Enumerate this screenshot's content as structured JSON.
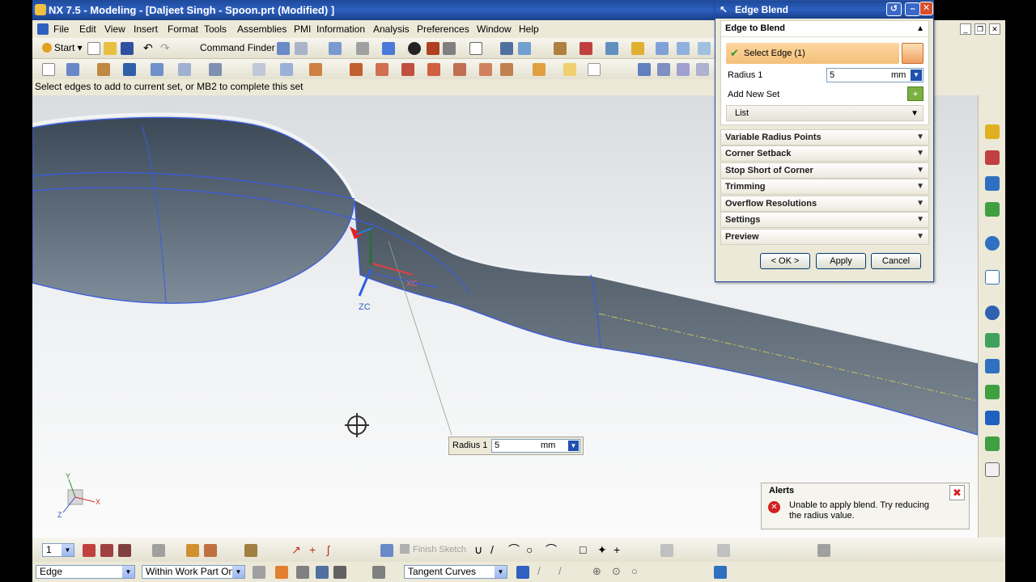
{
  "window": {
    "title": "NX 7.5 - Modeling - [Daljeet Singh - Spoon.prt (Modified) ]"
  },
  "menu": [
    "File",
    "Edit",
    "View",
    "Insert",
    "Format",
    "Tools",
    "Assemblies",
    "PMI",
    "Information",
    "Analysis",
    "Preferences",
    "Window",
    "Help"
  ],
  "toolbar": {
    "start_label": "Start",
    "command_finder_label": "Command Finder"
  },
  "status": {
    "prompt": "Select edges to add to current set, or MB2 to complete this set"
  },
  "dialog": {
    "title": "Edge Blend",
    "section_title": "Edge to Blend",
    "select_edge": "Select Edge (1)",
    "radius_label": "Radius 1",
    "radius_value": "5",
    "radius_unit": "mm",
    "add_new_set": "Add New Set",
    "list_label": "List",
    "collapsed_sections": [
      "Variable Radius Points",
      "Corner Setback",
      "Stop Short of Corner",
      "Trimming",
      "Overflow Resolutions",
      "Settings",
      "Preview"
    ],
    "ok_label": "< OK >",
    "apply_label": "Apply",
    "cancel_label": "Cancel"
  },
  "floating_radius": {
    "label": "Radius 1",
    "value": "5",
    "unit": "mm"
  },
  "alerts": {
    "title": "Alerts",
    "message_line1": "Unable to apply blend. Try reducing",
    "message_line2": "the radius value."
  },
  "viewport": {
    "wcs_label_zc": "ZC",
    "wcs_label_xc": "XC",
    "triad_x": "X",
    "triad_y": "Y",
    "triad_z": "Z"
  },
  "selection_bar": {
    "filter": "Edge",
    "scope": "Within Work Part Only",
    "curve_rule": "Tangent Curves"
  },
  "bottom_toolbar": {
    "layer_value": "1",
    "finish_sketch_label": "Finish Sketch"
  },
  "colors": {
    "title_blue": "#2c5fc0",
    "edge_highlight": "#3a5be0",
    "alert_red": "#d42020",
    "accent_orange": "#f4c07a"
  }
}
